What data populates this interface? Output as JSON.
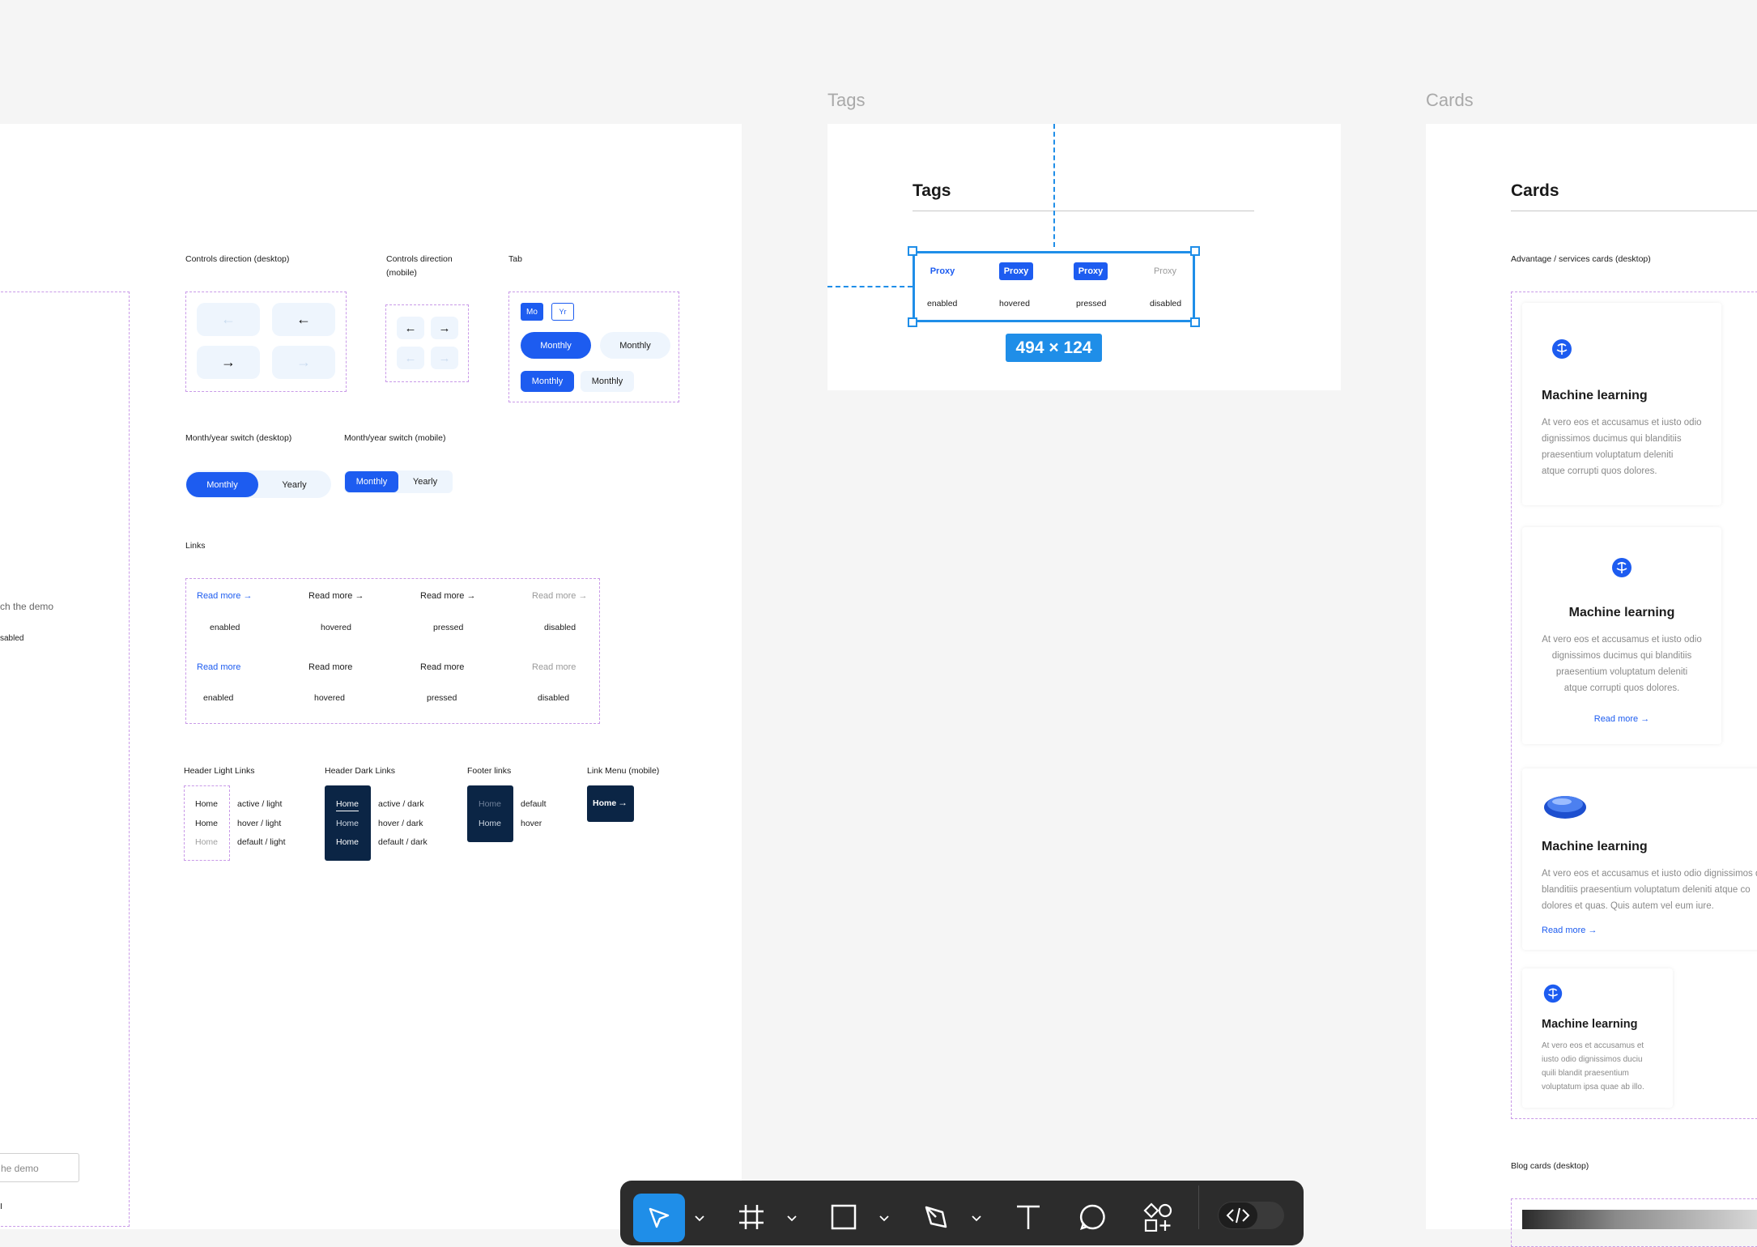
{
  "colors": {
    "accent": "#1d5cf0",
    "dark_navy": "#0b2545",
    "selection": "#1f8ee8",
    "dashed_outline": "#c99ae8"
  },
  "frames": {
    "tags_title": "Tags",
    "cards_title": "Cards"
  },
  "left_panel": {
    "partial_text_1": "ch the demo",
    "partial_text_2": "sabled",
    "partial_input": "he demo",
    "partial_text_3": "I"
  },
  "controls": {
    "desktop_label": "Controls direction (desktop)",
    "mobile_label_line1": "Controls direction",
    "mobile_label_line2": "(mobile)",
    "tab_label": "Tab",
    "left_arrow": "←",
    "right_arrow": "→",
    "tab_short_1": "Mo",
    "tab_short_2": "Yr",
    "monthly": "Monthly"
  },
  "switch": {
    "desktop_label": "Month/year switch (desktop)",
    "mobile_label": "Month/year switch (mobile)",
    "monthly": "Monthly",
    "yearly": "Yearly"
  },
  "links": {
    "section_label": "Links",
    "read_more": "Read more",
    "arrow": "→",
    "states": [
      "enabled",
      "hovered",
      "pressed",
      "disabled"
    ]
  },
  "nav_links": {
    "header_light_label": "Header Light Links",
    "header_dark_label": "Header Dark Links",
    "footer_label": "Footer links",
    "menu_mobile_label": "Link Menu (mobile)",
    "home": "Home",
    "light_states": [
      "active / light",
      "hover / light",
      "default / light"
    ],
    "dark_states": [
      "active / dark",
      "hover / dark",
      "default / dark"
    ],
    "footer_states": [
      "default",
      "hover"
    ]
  },
  "tags": {
    "heading": "Tags",
    "tag_text": "Proxy",
    "states": [
      "enabled",
      "hovered",
      "pressed",
      "disabled"
    ],
    "size_badge": "494 × 124"
  },
  "cards": {
    "heading": "Cards",
    "section_label": "Advantage / services cards (desktop)",
    "card_title": "Machine learning",
    "text_1": [
      "At vero eos et accusamus et iusto odio",
      "dignissimos ducimus qui blanditiis",
      "praesentium voluptatum deleniti",
      "atque corrupti quos dolores."
    ],
    "text_3": [
      "At vero eos et accusamus et iusto odio dignissimos d",
      "blanditiis praesentium voluptatum deleniti atque co",
      "dolores et quas. Quis autem vel eum iure."
    ],
    "text_4": [
      "At vero eos et accusamus et",
      "iusto odio dignissimos duciu",
      "quili blandit praesentium",
      "voluptatum ipsa quae ab illo."
    ],
    "read_more": "Read more →",
    "blog_label": "Blog cards (desktop)"
  },
  "toolbar": {
    "tools": [
      "move-tool",
      "frame-tool",
      "shape-tool",
      "pen-tool",
      "text-tool",
      "comment-tool",
      "components-tool",
      "dev-mode-toggle"
    ]
  }
}
